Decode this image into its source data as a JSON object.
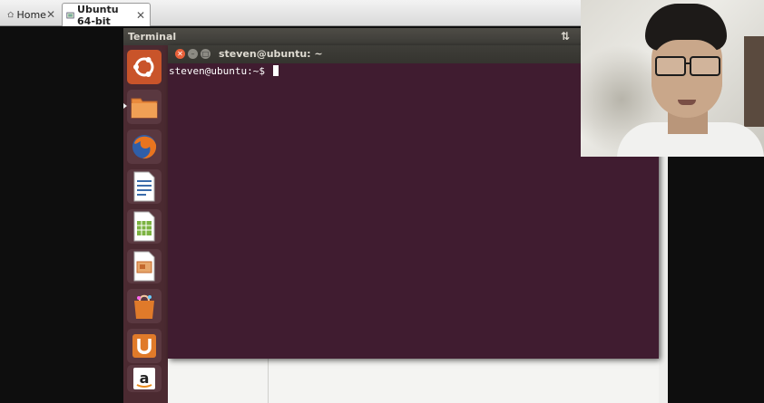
{
  "tabs": [
    {
      "label": "Home",
      "icon": "home-icon"
    },
    {
      "label": "Ubuntu 64-bit",
      "icon": "vm-icon"
    }
  ],
  "panel": {
    "title": "Terminal",
    "indicator_icon": "network-arrows-icon"
  },
  "launcher": {
    "items": [
      {
        "name": "dash-home",
        "icon": "ubuntu-logo-icon",
        "color": "#e05a2b"
      },
      {
        "name": "files",
        "icon": "folder-icon",
        "color": "#e98a3c"
      },
      {
        "name": "firefox",
        "icon": "firefox-icon",
        "color": "#3a6fb8"
      },
      {
        "name": "libreoffice-writer",
        "icon": "writer-icon",
        "color": "#4a78b0"
      },
      {
        "name": "libreoffice-calc",
        "icon": "calc-icon",
        "color": "#4a9a3a"
      },
      {
        "name": "libreoffice-impress",
        "icon": "impress-icon",
        "color": "#c4682e"
      },
      {
        "name": "software-center",
        "icon": "bag-icon",
        "color": "#e07a2a"
      },
      {
        "name": "ubuntu-one",
        "icon": "ubuntu-one-icon",
        "color": "#e07a2a"
      },
      {
        "name": "amazon",
        "icon": "amazon-icon",
        "color": "#ffffff"
      }
    ]
  },
  "terminal": {
    "title": "steven@ubuntu: ~",
    "prompt": "steven@ubuntu:~$ ",
    "background": "#401c30"
  }
}
